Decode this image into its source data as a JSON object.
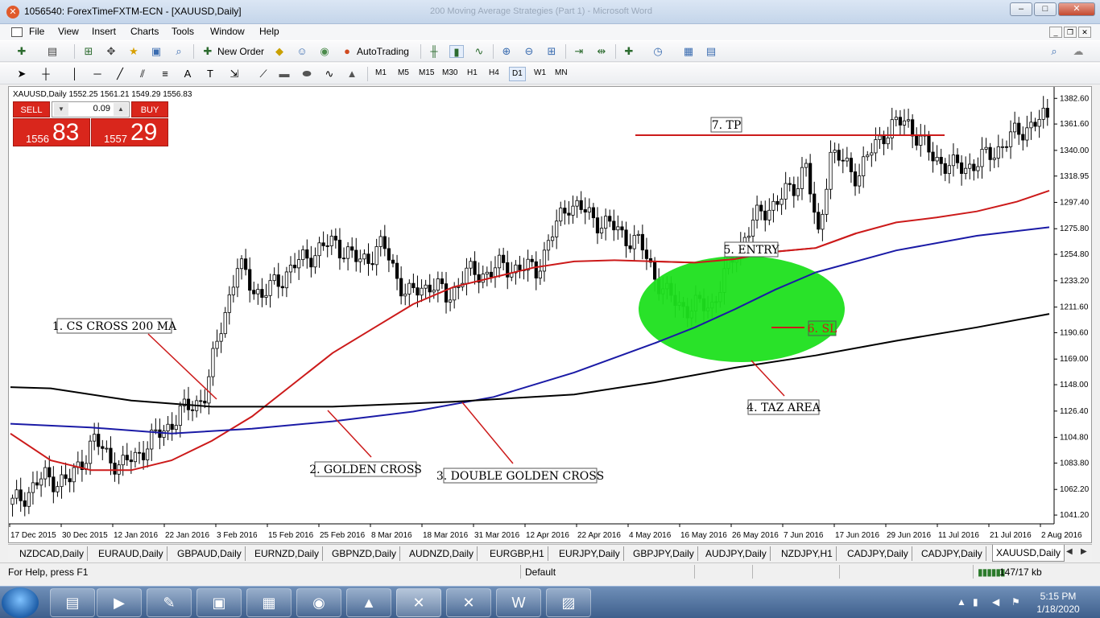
{
  "window": {
    "title": "1056540: ForexTimeFXTM-ECN - [XAUUSD,Daily]",
    "ghost_title": "200 Moving Average Strategies (Part 1) - Microsoft Word",
    "controls": [
      "–",
      "□",
      "✕"
    ]
  },
  "menu": [
    "File",
    "View",
    "Insert",
    "Charts",
    "Tools",
    "Window",
    "Help"
  ],
  "toolbar": {
    "new_order": "New Order",
    "autotrading": "AutoTrading",
    "timeframes": [
      "M1",
      "M5",
      "M15",
      "M30",
      "H1",
      "H4",
      "D1",
      "W1",
      "MN"
    ],
    "active_timeframe": "D1"
  },
  "trade_panel": {
    "sell_label": "SELL",
    "buy_label": "BUY",
    "lot": "0.09",
    "sell_price_small": "1556",
    "sell_price_big": "83",
    "buy_price_small": "1557",
    "buy_price_big": "29",
    "color": "#d9261c"
  },
  "chart_data": {
    "type": "candlestick",
    "symbol_header": "XAUUSD,Daily  1552.25 1561.21 1549.29 1556.83",
    "y_ticks": [
      1382.6,
      1361.6,
      1340.0,
      1318.95,
      1297.4,
      1275.8,
      1254.8,
      1233.2,
      1211.6,
      1190.6,
      1169.0,
      1148.0,
      1126.4,
      1104.8,
      1083.8,
      1062.2,
      1041.2
    ],
    "ylim": [
      1034.0,
      1392.0
    ],
    "x_ticks": [
      "17 Dec 2015",
      "30 Dec 2015",
      "12 Jan 2016",
      "22 Jan 2016",
      "3 Feb 2016",
      "15 Feb 2016",
      "25 Feb 2016",
      "8 Mar 2016",
      "18 Mar 2016",
      "31 Mar 2016",
      "12 Apr 2016",
      "22 Apr 2016",
      "4 May 2016",
      "16 May 2016",
      "26 May 2016",
      "7 Jun 2016",
      "17 Jun 2016",
      "29 Jun 2016",
      "11 Jul 2016",
      "21 Jul 2016",
      "2 Aug 2016"
    ],
    "bar_count": 167,
    "candle_anchors": [
      [
        0,
        1050
      ],
      [
        8,
        1072
      ],
      [
        14,
        1068
      ],
      [
        20,
        1102
      ],
      [
        27,
        1080
      ],
      [
        34,
        1100
      ],
      [
        42,
        1125
      ],
      [
        48,
        1140
      ],
      [
        52,
        1200
      ],
      [
        56,
        1245
      ],
      [
        62,
        1220
      ],
      [
        68,
        1240
      ],
      [
        74,
        1255
      ],
      [
        80,
        1265
      ],
      [
        86,
        1248
      ],
      [
        92,
        1262
      ],
      [
        98,
        1220
      ],
      [
        104,
        1232
      ],
      [
        108,
        1218
      ],
      [
        112,
        1238
      ],
      [
        118,
        1240
      ],
      [
        122,
        1245
      ],
      [
        130,
        1242
      ],
      [
        138,
        1298
      ],
      [
        144,
        1285
      ],
      [
        150,
        1275
      ],
      [
        156,
        1262
      ],
      [
        162,
        1222
      ],
      [
        168,
        1210
      ],
      [
        174,
        1215
      ],
      [
        180,
        1260
      ],
      [
        186,
        1290
      ],
      [
        191,
        1300
      ],
      [
        195,
        1315
      ],
      [
        197,
        1330
      ],
      [
        200,
        1265
      ],
      [
        203,
        1338
      ],
      [
        210,
        1320
      ],
      [
        216,
        1354
      ],
      [
        222,
        1365
      ],
      [
        228,
        1336
      ],
      [
        234,
        1325
      ],
      [
        240,
        1330
      ],
      [
        246,
        1345
      ],
      [
        252,
        1360
      ],
      [
        256,
        1365
      ]
    ],
    "series": [
      {
        "color": "#cc1a1a",
        "values": [
          [
            0,
            1108
          ],
          [
            10,
            1086
          ],
          [
            20,
            1078
          ],
          [
            30,
            1078
          ],
          [
            40,
            1086
          ],
          [
            50,
            1102
          ],
          [
            60,
            1122
          ],
          [
            70,
            1148
          ],
          [
            80,
            1174
          ],
          [
            90,
            1194
          ],
          [
            100,
            1214
          ],
          [
            110,
            1228
          ],
          [
            120,
            1236
          ],
          [
            130,
            1244
          ],
          [
            140,
            1249
          ],
          [
            150,
            1250
          ],
          [
            160,
            1249
          ],
          [
            170,
            1248
          ],
          [
            180,
            1251
          ],
          [
            190,
            1257
          ],
          [
            200,
            1260
          ],
          [
            210,
            1272
          ],
          [
            220,
            1281
          ],
          [
            230,
            1285
          ],
          [
            240,
            1290
          ],
          [
            250,
            1298
          ],
          [
            258,
            1307
          ]
        ]
      },
      {
        "color": "#1a1aa6",
        "values": [
          [
            0,
            1116
          ],
          [
            20,
            1113
          ],
          [
            40,
            1108
          ],
          [
            60,
            1112
          ],
          [
            80,
            1118
          ],
          [
            100,
            1126
          ],
          [
            120,
            1138
          ],
          [
            140,
            1158
          ],
          [
            160,
            1182
          ],
          [
            170,
            1195
          ],
          [
            180,
            1210
          ],
          [
            190,
            1226
          ],
          [
            200,
            1240
          ],
          [
            220,
            1258
          ],
          [
            240,
            1270
          ],
          [
            258,
            1277
          ]
        ]
      },
      {
        "color": "#000000",
        "values": [
          [
            0,
            1146
          ],
          [
            10,
            1145
          ],
          [
            30,
            1135
          ],
          [
            50,
            1130
          ],
          [
            80,
            1130
          ],
          [
            110,
            1134
          ],
          [
            140,
            1140
          ],
          [
            160,
            1150
          ],
          [
            180,
            1162
          ],
          [
            200,
            1172
          ],
          [
            220,
            1184
          ],
          [
            240,
            1195
          ],
          [
            258,
            1206
          ]
        ]
      }
    ],
    "annotations": [
      {
        "label": "1. CS CROSS 200 MA"
      },
      {
        "label": "2. GOLDEN CROSS"
      },
      {
        "label": "3. DOUBLE GOLDEN CROSS"
      },
      {
        "label": "4. TAZ AREA"
      },
      {
        "label": "5. ENTRY"
      },
      {
        "label": "6. SL"
      },
      {
        "label": "7. TP"
      }
    ],
    "grid": false,
    "taz_color": "#1ee01e"
  },
  "tabs": [
    "NZDCAD,Daily",
    "EURAUD,Daily",
    "GBPAUD,Daily",
    "EURNZD,Daily",
    "GBPNZD,Daily",
    "AUDNZD,Daily",
    "EURGBP,H1",
    "EURJPY,Daily",
    "GBPJPY,Daily",
    "AUDJPY,Daily",
    "NZDJPY,H1",
    "CADJPY,Daily",
    "CADJPY,Daily",
    "XAUUSD,Daily"
  ],
  "active_tab": "XAUUSD,Daily",
  "status": {
    "help": "For Help, press F1",
    "profile": "Default",
    "traffic": "147/17 kb"
  },
  "taskbar": {
    "time": "5:15 PM",
    "date": "1/18/2020"
  }
}
